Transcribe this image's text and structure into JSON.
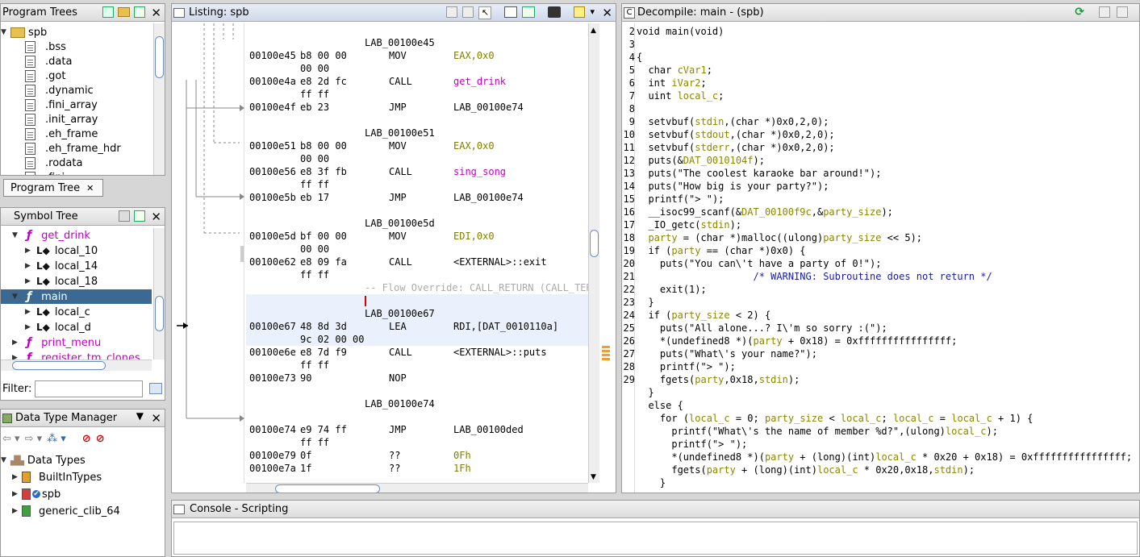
{
  "program_trees": {
    "title": "Program Trees",
    "root": "spb",
    "items": [
      ".bss",
      ".data",
      ".got",
      ".dynamic",
      ".fini_array",
      ".init_array",
      ".eh_frame",
      ".eh_frame_hdr",
      ".rodata",
      ".fini"
    ],
    "tab_label": "Program Tree"
  },
  "symbol_tree": {
    "title": "Symbol Tree",
    "items": [
      {
        "label": "get_drink",
        "kind": "func",
        "level": 1,
        "expanded": true
      },
      {
        "label": "local_10",
        "kind": "local",
        "level": 2
      },
      {
        "label": "local_14",
        "kind": "local",
        "level": 2
      },
      {
        "label": "local_18",
        "kind": "local",
        "level": 2
      },
      {
        "label": "main",
        "kind": "func",
        "level": 1,
        "expanded": true,
        "selected": true
      },
      {
        "label": "local_c",
        "kind": "local",
        "level": 2
      },
      {
        "label": "local_d",
        "kind": "local",
        "level": 2
      },
      {
        "label": "print_menu",
        "kind": "func",
        "level": 1
      },
      {
        "label": "register_tm_clones",
        "kind": "func",
        "level": 1
      }
    ],
    "filter_label": "Filter:",
    "filter_value": ""
  },
  "data_type_manager": {
    "title": "Data Type Manager",
    "root": "Data Types",
    "items": [
      "BuiltInTypes",
      "spb",
      "generic_clib_64"
    ]
  },
  "listing": {
    "title": "Listing:  spb",
    "override_comment": "-- Flow Override: CALL_RETURN (CALL_TERM",
    "lines": [
      {
        "type": "label",
        "text": "LAB_00100e45"
      },
      {
        "type": "insn",
        "addr": "00100e45",
        "bytes": "b8 00 00",
        "mnem": "MOV",
        "op": "EAX,0x0",
        "opclass": "reg"
      },
      {
        "type": "cont",
        "bytes": "00 00"
      },
      {
        "type": "insn",
        "addr": "00100e4a",
        "bytes": "e8 2d fc",
        "mnem": "CALL",
        "op": "get_drink",
        "opclass": "func"
      },
      {
        "type": "cont",
        "bytes": "ff ff"
      },
      {
        "type": "insn",
        "addr": "00100e4f",
        "bytes": "eb 23",
        "mnem": "JMP",
        "op": "LAB_00100e74",
        "opclass": "plain"
      },
      {
        "type": "blank"
      },
      {
        "type": "label",
        "text": "LAB_00100e51"
      },
      {
        "type": "insn",
        "addr": "00100e51",
        "bytes": "b8 00 00",
        "mnem": "MOV",
        "op": "EAX,0x0",
        "opclass": "reg"
      },
      {
        "type": "cont",
        "bytes": "00 00"
      },
      {
        "type": "insn",
        "addr": "00100e56",
        "bytes": "e8 3f fb",
        "mnem": "CALL",
        "op": "sing_song",
        "opclass": "func"
      },
      {
        "type": "cont",
        "bytes": "ff ff"
      },
      {
        "type": "insn",
        "addr": "00100e5b",
        "bytes": "eb 17",
        "mnem": "JMP",
        "op": "LAB_00100e74",
        "opclass": "plain"
      },
      {
        "type": "blank"
      },
      {
        "type": "label",
        "text": "LAB_00100e5d"
      },
      {
        "type": "insn",
        "addr": "00100e5d",
        "bytes": "bf 00 00",
        "mnem": "MOV",
        "op": "EDI,0x0",
        "opclass": "reg"
      },
      {
        "type": "cont",
        "bytes": "00 00"
      },
      {
        "type": "insn",
        "addr": "00100e62",
        "bytes": "e8 09 fa",
        "mnem": "CALL",
        "op": "<EXTERNAL>::exit",
        "opclass": "plain"
      },
      {
        "type": "cont",
        "bytes": "ff ff"
      },
      {
        "type": "comment"
      },
      {
        "type": "cursor"
      },
      {
        "type": "label",
        "text": "LAB_00100e67"
      },
      {
        "type": "insn",
        "addr": "00100e67",
        "bytes": "48 8d 3d",
        "mnem": "LEA",
        "op": "RDI,[DAT_0010110a]",
        "opclass": "plain"
      },
      {
        "type": "cont",
        "bytes": "9c 02 00 00"
      },
      {
        "type": "insn",
        "addr": "00100e6e",
        "bytes": "e8 7d f9",
        "mnem": "CALL",
        "op": "<EXTERNAL>::puts",
        "opclass": "plain"
      },
      {
        "type": "cont",
        "bytes": "ff ff"
      },
      {
        "type": "insn",
        "addr": "00100e73",
        "bytes": "90",
        "mnem": "NOP",
        "op": "",
        "opclass": "plain"
      },
      {
        "type": "blank"
      },
      {
        "type": "label",
        "text": "LAB_00100e74"
      },
      {
        "type": "blank"
      },
      {
        "type": "insn",
        "addr": "00100e74",
        "bytes": "e9 74 ff",
        "mnem": "JMP",
        "op": "LAB_00100ded",
        "opclass": "plain"
      },
      {
        "type": "cont",
        "bytes": "ff ff"
      },
      {
        "type": "insn",
        "addr": "00100e79",
        "bytes": "0f",
        "mnem": "??",
        "op": "0Fh",
        "opclass": "reg"
      },
      {
        "type": "insn",
        "addr": "00100e7a",
        "bytes": "1f",
        "mnem": "??",
        "op": "1Fh",
        "opclass": "reg"
      }
    ]
  },
  "decompile": {
    "title": "Decompile: main -  (spb)",
    "lines": [
      {
        "n": "2",
        "t": "void main(void)"
      },
      {
        "n": "3",
        "t": ""
      },
      {
        "n": "4",
        "t": "{"
      },
      {
        "n": "5",
        "t": "  char cVar1;"
      },
      {
        "n": "6",
        "t": "  int iVar2;"
      },
      {
        "n": "7",
        "t": "  uint local_c;"
      },
      {
        "n": "8",
        "t": ""
      },
      {
        "n": "9",
        "t": "  setvbuf(stdin,(char *)0x0,2,0);"
      },
      {
        "n": "10",
        "t": "  setvbuf(stdout,(char *)0x0,2,0);"
      },
      {
        "n": "11",
        "t": "  setvbuf(stderr,(char *)0x0,2,0);"
      },
      {
        "n": "12",
        "t": "  puts(&DAT_0010104f);"
      },
      {
        "n": "13",
        "t": "  puts(\"The coolest karaoke bar around!\");"
      },
      {
        "n": "14",
        "t": "  puts(\"How big is your party?\");"
      },
      {
        "n": "15",
        "t": "  printf(\"> \");"
      },
      {
        "n": "16",
        "t": "  __isoc99_scanf(&DAT_00100f9c,&party_size);"
      },
      {
        "n": "17",
        "t": "  _IO_getc(stdin);"
      },
      {
        "n": "18",
        "t": "  party = (char *)malloc((ulong)party_size << 5);"
      },
      {
        "n": "19",
        "t": "  if (party == (char *)0x0) {"
      },
      {
        "n": "20",
        "t": "    puts(\"You can\\'t have a party of 0!\");"
      },
      {
        "n": "21",
        "t": "                    /* WARNING: Subroutine does not return */"
      },
      {
        "n": "22",
        "t": "    exit(1);"
      },
      {
        "n": "23",
        "t": "  }"
      },
      {
        "n": "24",
        "t": "  if (party_size < 2) {"
      },
      {
        "n": "25",
        "t": "    puts(\"All alone...? I\\'m so sorry :(\");"
      },
      {
        "n": "26",
        "t": "    *(undefined8 *)(party + 0x18) = 0xffffffffffffffff;"
      },
      {
        "n": "27",
        "t": "    puts(\"What\\'s your name?\");"
      },
      {
        "n": "28",
        "t": "    printf(\"> \");"
      },
      {
        "n": "29",
        "t": "    fgets(party,0x18,stdin);"
      },
      {
        "n": "",
        "t": "  }"
      },
      {
        "n": "",
        "t": "  else {"
      },
      {
        "n": "",
        "t": "    for (local_c = 0; party_size < local_c; local_c = local_c + 1) {"
      },
      {
        "n": "",
        "t": "      printf(\"What\\'s the name of member %d?\",(ulong)local_c);"
      },
      {
        "n": "",
        "t": "      printf(\"> \");"
      },
      {
        "n": "",
        "t": "      *(undefined8 *)(party + (long)(int)local_c * 0x20 + 0x18) = 0xffffffffffffffff;"
      },
      {
        "n": "",
        "t": "      fgets(party + (long)(int)local_c * 0x20,0x18,stdin);"
      },
      {
        "n": "",
        "t": "    }"
      }
    ]
  },
  "console": {
    "title": "Console - Scripting"
  }
}
